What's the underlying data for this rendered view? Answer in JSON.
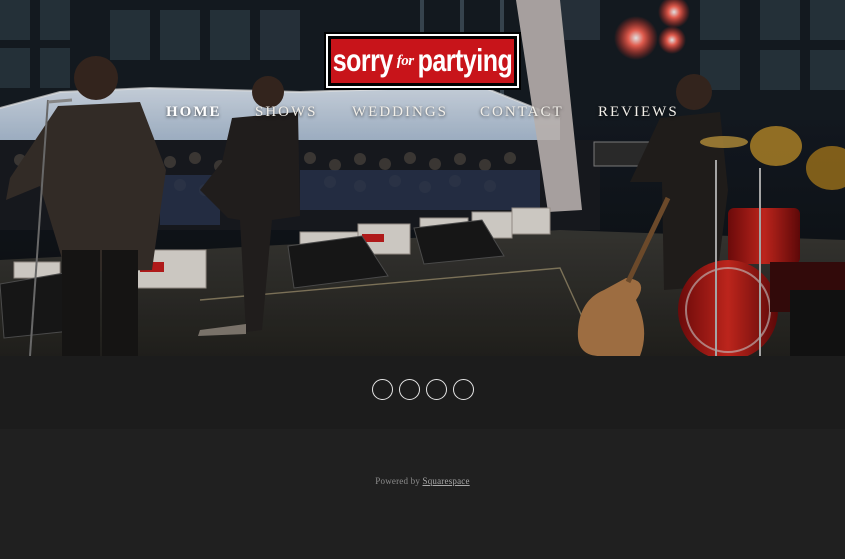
{
  "logo": {
    "word1": "sorry",
    "word2": "for",
    "word3": "partying",
    "colors": {
      "background": "#c8141a",
      "text": "#ffffff",
      "frame": "#000000"
    }
  },
  "nav": {
    "items": [
      {
        "label": "HOME",
        "active": true
      },
      {
        "label": "SHOWS",
        "active": false
      },
      {
        "label": "WEDDINGS",
        "active": false
      },
      {
        "label": "CONTACT",
        "active": false
      },
      {
        "label": "REVIEWS",
        "active": false
      }
    ]
  },
  "social": {
    "icons": [
      "social-icon-1",
      "social-icon-2",
      "social-icon-3",
      "social-icon-4"
    ]
  },
  "footer": {
    "powered_prefix": "Powered by",
    "powered_link": "Squarespace"
  },
  "colors": {
    "social_bar": "#1c1c1c",
    "footer": "#202020"
  }
}
